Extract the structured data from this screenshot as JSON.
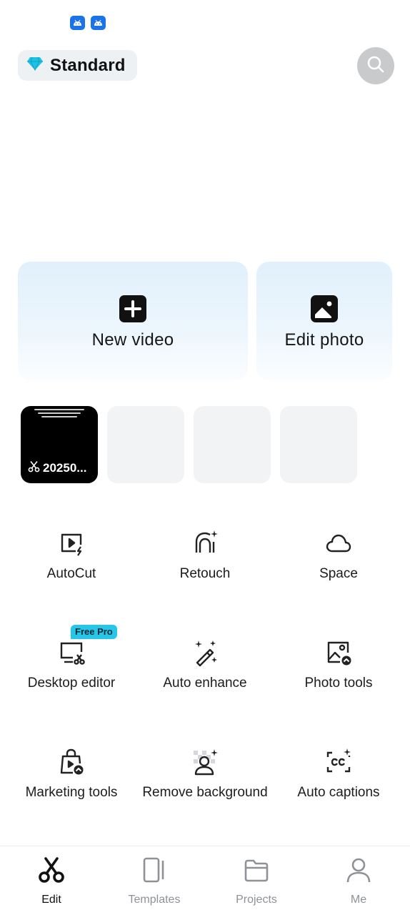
{
  "status_bar": {
    "icons": [
      "android-notification-icon",
      "android-notification-icon"
    ],
    "icon_color": "#1a73e8"
  },
  "header": {
    "plan_label": "Standard",
    "plan_icon": "diamond-icon",
    "plan_icon_color": "#1fc2e3",
    "search_icon": "search-icon"
  },
  "create_cards": {
    "new_video_label": "New video",
    "edit_photo_label": "Edit photo"
  },
  "recent_projects": [
    {
      "caption": "20250...",
      "has_thumbnail": true
    },
    {
      "caption": "",
      "has_thumbnail": false
    },
    {
      "caption": "",
      "has_thumbnail": false
    },
    {
      "caption": "",
      "has_thumbnail": false
    }
  ],
  "tools": [
    {
      "label": "AutoCut",
      "icon": "autocut-icon"
    },
    {
      "label": "Retouch",
      "icon": "retouch-icon"
    },
    {
      "label": "Space",
      "icon": "cloud-icon"
    },
    {
      "label": "Desktop editor",
      "icon": "desktop-editor-icon",
      "badge": "Free Pro"
    },
    {
      "label": "Auto enhance",
      "icon": "magic-wand-icon"
    },
    {
      "label": "Photo tools",
      "icon": "photo-tools-icon"
    },
    {
      "label": "Marketing tools",
      "icon": "shopping-bag-icon"
    },
    {
      "label": "Remove background",
      "icon": "remove-background-icon"
    },
    {
      "label": "Auto captions",
      "icon": "captions-icon"
    }
  ],
  "bottom_nav": [
    {
      "label": "Edit",
      "icon": "scissors-icon",
      "active": true
    },
    {
      "label": "Templates",
      "icon": "templates-icon",
      "active": false
    },
    {
      "label": "Projects",
      "icon": "folder-icon",
      "active": false
    },
    {
      "label": "Me",
      "icon": "person-icon",
      "active": false
    }
  ],
  "colors": {
    "accent": "#25c6e8",
    "inactive_nav": "#8e9196"
  }
}
